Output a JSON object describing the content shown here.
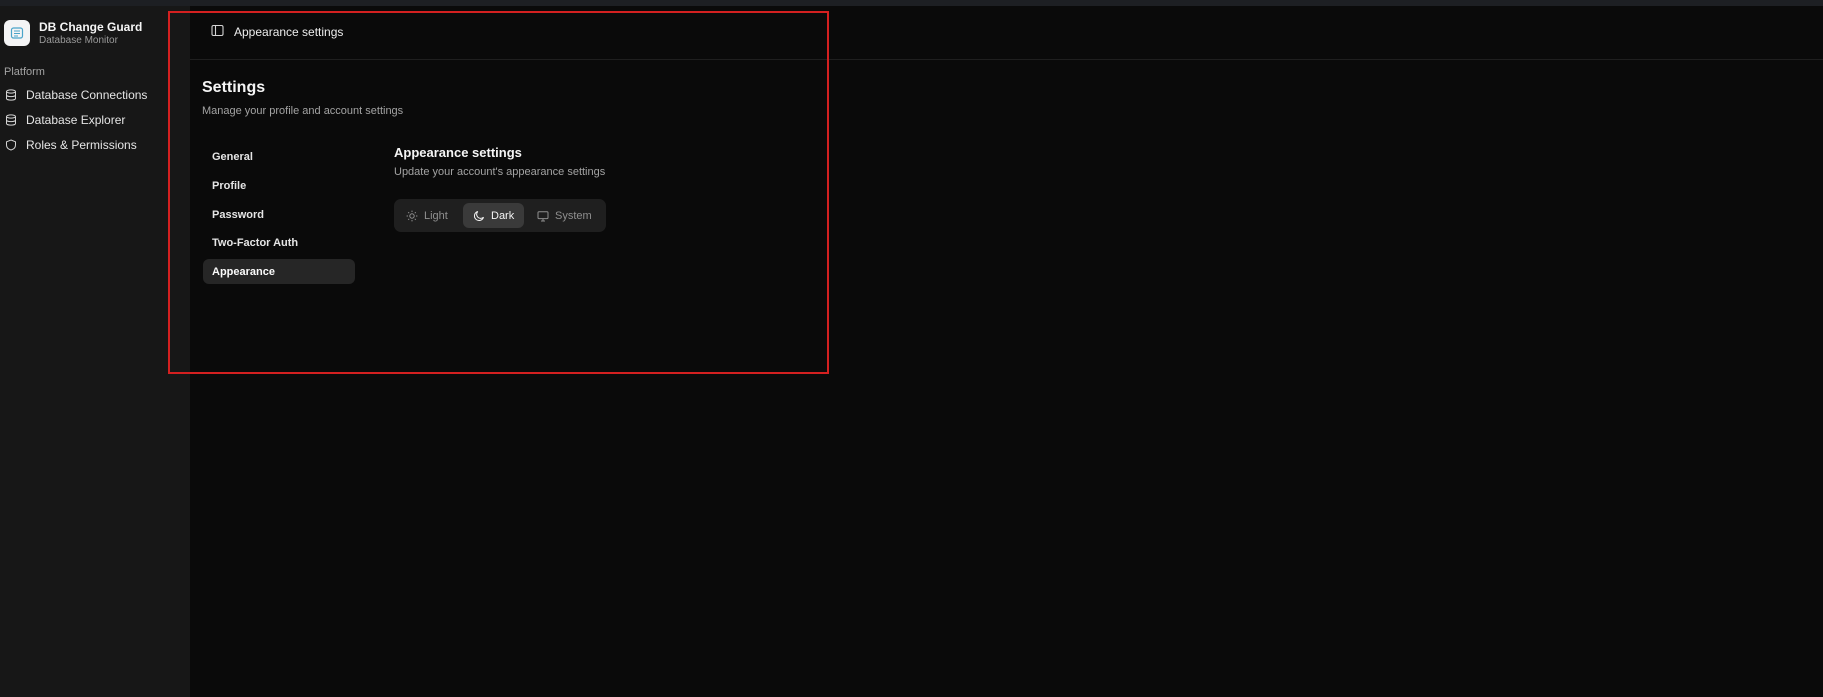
{
  "brand": {
    "name": "DB Change Guard",
    "subtitle": "Database Monitor",
    "logo_icon": "database-logo-icon"
  },
  "sidebar": {
    "group_label": "Platform",
    "items": [
      {
        "label": "Database Connections",
        "icon": "database-icon"
      },
      {
        "label": "Database Explorer",
        "icon": "database-icon"
      },
      {
        "label": "Roles & Permissions",
        "icon": "shield-icon"
      }
    ]
  },
  "header": {
    "title": "Appearance settings",
    "toggle_icon": "sidebar-toggle-icon"
  },
  "settings": {
    "title": "Settings",
    "subtitle": "Manage your profile and account settings",
    "nav": [
      {
        "label": "General",
        "active": false
      },
      {
        "label": "Profile",
        "active": false
      },
      {
        "label": "Password",
        "active": false
      },
      {
        "label": "Two-Factor Auth",
        "active": false
      },
      {
        "label": "Appearance",
        "active": true
      }
    ]
  },
  "appearance": {
    "title": "Appearance settings",
    "subtitle": "Update your account's appearance settings",
    "options": [
      {
        "label": "Light",
        "icon": "sun-icon",
        "selected": false
      },
      {
        "label": "Dark",
        "icon": "moon-icon",
        "selected": true
      },
      {
        "label": "System",
        "icon": "monitor-icon",
        "selected": false
      }
    ]
  },
  "colors": {
    "background": "#0a0a0a",
    "sidebar": "#171717",
    "active_item": "#262626",
    "highlight": "#d42020"
  }
}
